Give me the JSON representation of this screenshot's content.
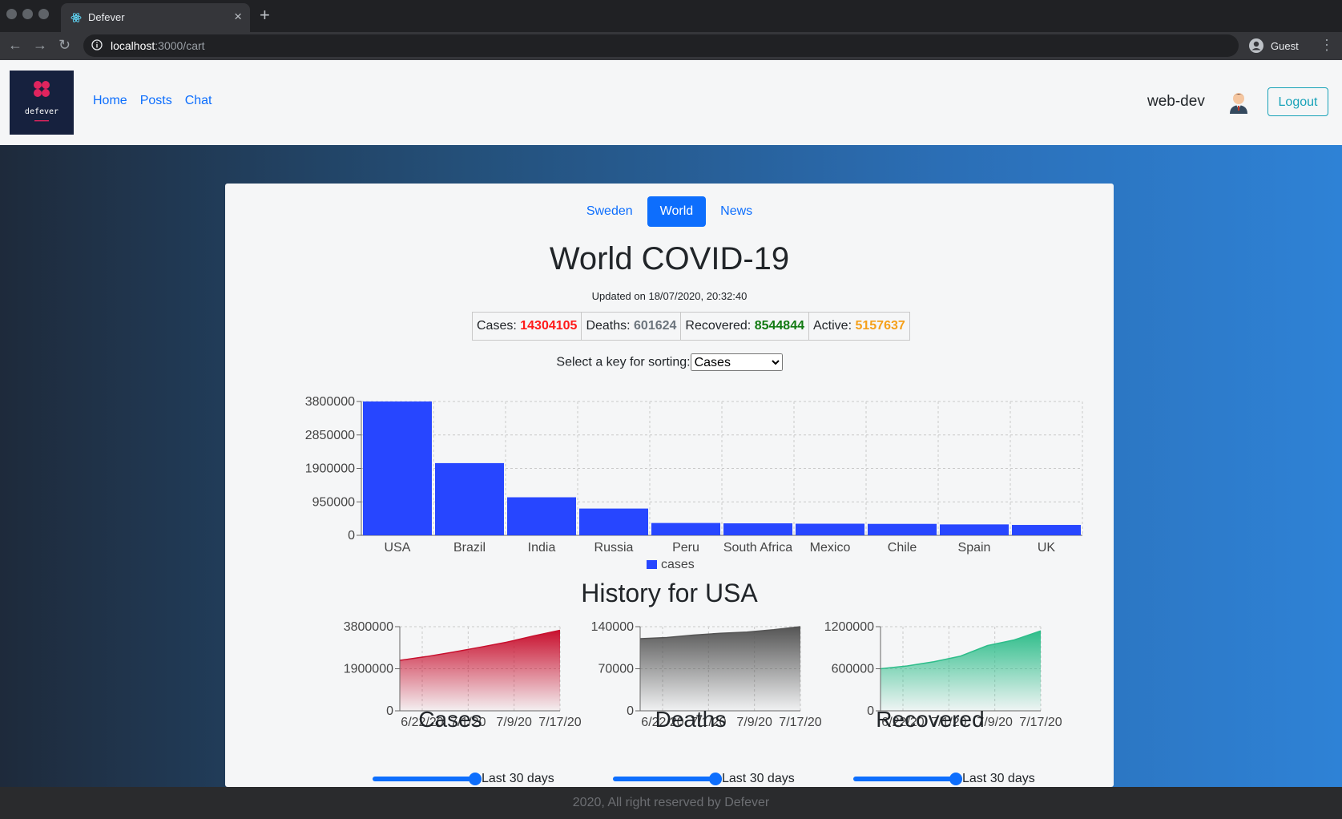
{
  "browser": {
    "tab_title": "Defever",
    "url_host": "localhost",
    "url_path": ":3000/cart",
    "profile_label": "Guest"
  },
  "navbar": {
    "logo_text": "defever",
    "links": [
      "Home",
      "Posts",
      "Chat"
    ],
    "username": "web-dev",
    "logout_label": "Logout"
  },
  "pills": [
    "Sweden",
    "World",
    "News"
  ],
  "active_pill": "World",
  "page": {
    "title": "World COVID-19",
    "updated": "Updated on 18/07/2020, 20:32:40"
  },
  "stats": [
    {
      "label": "Cases:",
      "value": "14304105",
      "color": "#ff1a1a"
    },
    {
      "label": "Deaths:",
      "value": "601624",
      "color": "#6c757d"
    },
    {
      "label": "Recovered:",
      "value": "8544844",
      "color": "#127a12"
    },
    {
      "label": "Active:",
      "value": "5157637",
      "color": "#f5a01a"
    }
  ],
  "sort": {
    "label": "Select a key for sorting:",
    "selected": "Cases"
  },
  "chart_data": [
    {
      "type": "bar",
      "categories": [
        "USA",
        "Brazil",
        "India",
        "Russia",
        "Peru",
        "South Africa",
        "Mexico",
        "Chile",
        "Spain",
        "UK"
      ],
      "series": [
        {
          "name": "cases",
          "values": [
            3800000,
            2050000,
            1080000,
            760000,
            350000,
            340000,
            330000,
            325000,
            310000,
            295000
          ],
          "color": "#2746ff"
        }
      ],
      "y_ticks": [
        "0",
        "950000",
        "1900000",
        "2850000",
        "3800000"
      ],
      "ylim": [
        0,
        3800000
      ],
      "grid": true,
      "legend": "bottom"
    },
    {
      "type": "area",
      "title": "Cases",
      "x_ticks": [
        "6/22/20",
        "7/1/20",
        "7/9/20",
        "7/17/20"
      ],
      "y_ticks": [
        "0",
        "1900000",
        "3800000"
      ],
      "ylim": [
        0,
        3800000
      ],
      "values": [
        2280000,
        2450000,
        2650000,
        2870000,
        3100000,
        3380000,
        3640000
      ],
      "color": "#c8102e"
    },
    {
      "type": "area",
      "title": "Deaths",
      "x_ticks": [
        "6/22/20",
        "7/1/20",
        "7/9/20",
        "7/17/20"
      ],
      "y_ticks": [
        "0",
        "70000",
        "140000"
      ],
      "ylim": [
        0,
        140000
      ],
      "values": [
        120000,
        122000,
        126000,
        129000,
        131000,
        135000,
        140000
      ],
      "color": "#555555"
    },
    {
      "type": "area",
      "title": "Recovered",
      "x_ticks": [
        "6/22/20",
        "7/1/20",
        "7/9/20",
        "7/17/20"
      ],
      "y_ticks": [
        "0",
        "600000",
        "1200000"
      ],
      "ylim": [
        0,
        1200000
      ],
      "values": [
        600000,
        640000,
        700000,
        780000,
        930000,
        1010000,
        1140000
      ],
      "color": "#2ebd8a"
    }
  ],
  "history": {
    "title": "History for USA",
    "slider_label": "Last 30 days"
  },
  "footer": "2020, All right reserved by Defever"
}
